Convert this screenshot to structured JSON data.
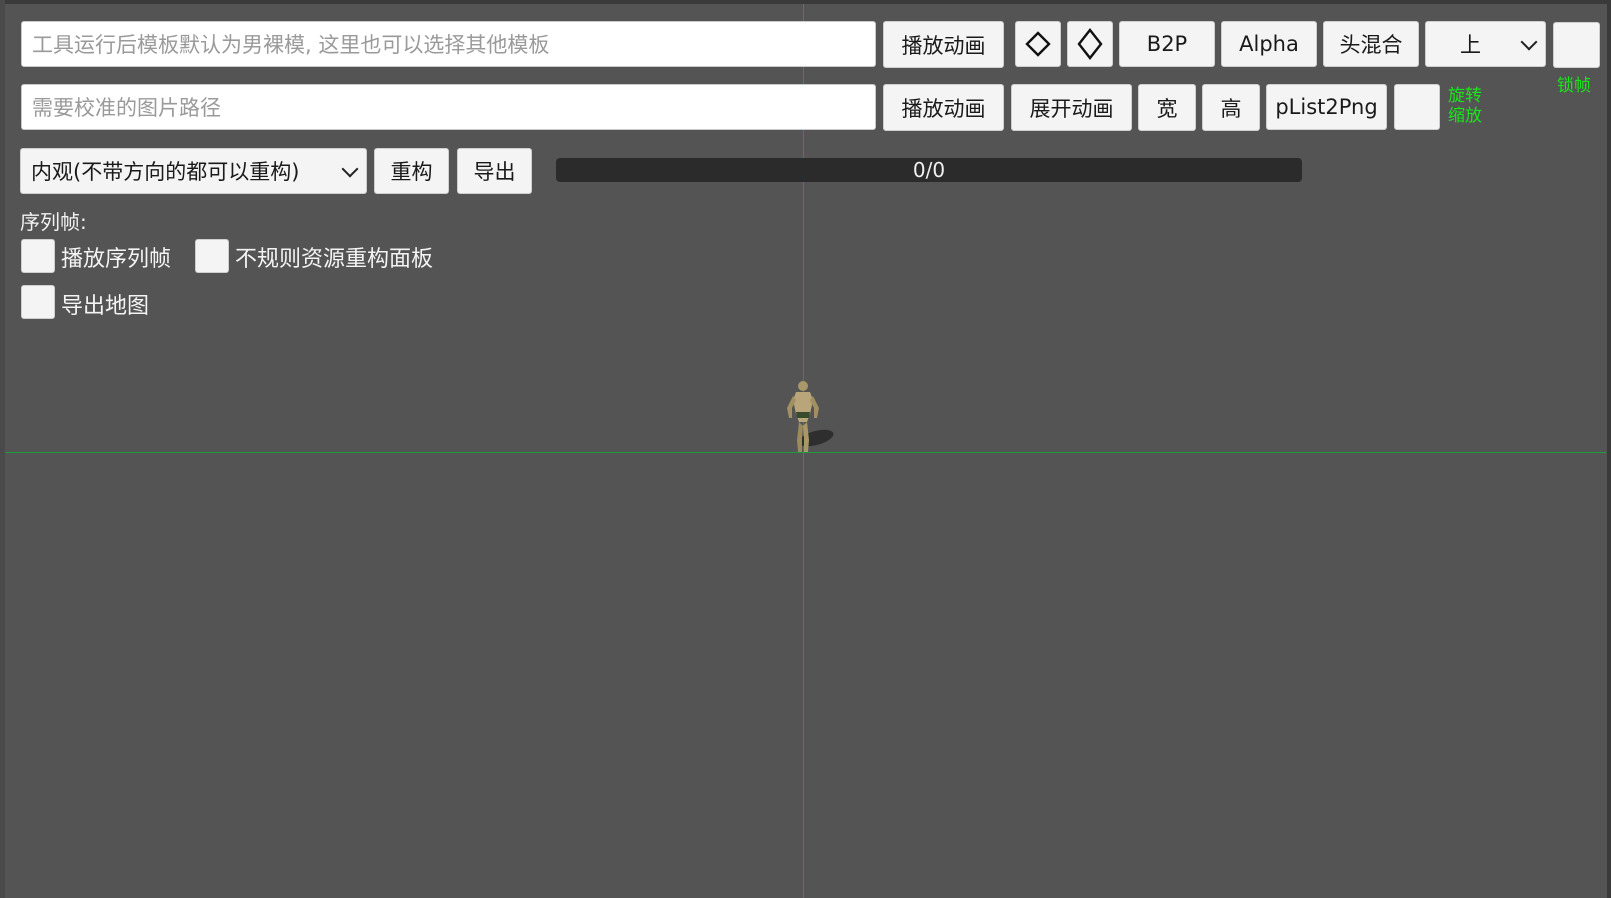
{
  "row1": {
    "template_input_placeholder": "工具运行后模板默认为男裸模, 这里也可以选择其他模板",
    "play_button": "播放动画",
    "diamond_h_icon": "diamond-outline-icon",
    "diamond_v_icon": "diamond-tall-outline-icon",
    "b2p_button": "B2P",
    "alpha_button": "Alpha",
    "head_blend_button": "头混合",
    "direction_select": "上",
    "lock_frame_label": "锁帧"
  },
  "row2": {
    "image_path_placeholder": "需要校准的图片路径",
    "play_button": "播放动画",
    "expand_button": "展开动画",
    "width_button": "宽",
    "height_button": "高",
    "plist_button": "pList2Png",
    "rotate_label": "旋转",
    "scale_label": "缩放"
  },
  "row3": {
    "mode_select": "内观(不带方向的都可以重构)",
    "rebuild_button": "重构",
    "export_button": "导出",
    "progress_text": "0/0"
  },
  "sequence": {
    "heading": "序列帧:",
    "play_sequence": "播放序列帧",
    "irregular_panel": "不规则资源重构面板",
    "export_map": "导出地图"
  },
  "colors": {
    "background": "#545454",
    "guide_line": "#1f9a3c",
    "accent_label": "#19e619",
    "progress_track": "#2b2b2b"
  }
}
